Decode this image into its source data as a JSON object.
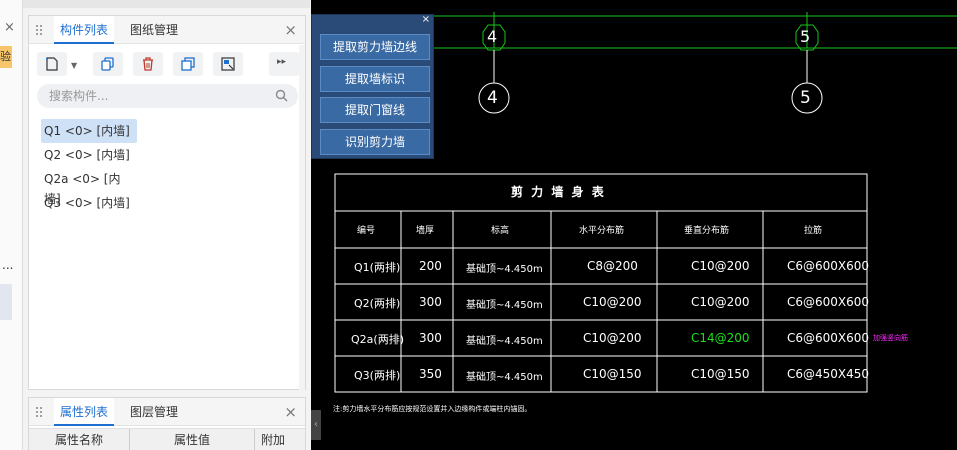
{
  "left_strip": {
    "close_glyph": "×",
    "badge": "验",
    "ellipsis": "..."
  },
  "component_panel": {
    "tabs": [
      "构件列表",
      "图纸管理"
    ],
    "close_glyph": "×",
    "search_placeholder": "搜索构件...",
    "items": [
      "Q1 <0> [内墙]",
      "Q2 <0> [内墙]",
      "Q2a <0> [内墙]",
      "Q3 <0> [内墙]"
    ],
    "selected_index": 0,
    "more_glyph": "▸▸"
  },
  "property_panel": {
    "tabs": [
      "属性列表",
      "图层管理"
    ],
    "close_glyph": "×",
    "columns": [
      "属性名称",
      "属性值",
      "附加"
    ]
  },
  "command_panel": {
    "close_glyph": "×",
    "buttons": [
      "提取剪力墙边线",
      "提取墙标识",
      "提取门窗线",
      "识别剪力墙"
    ]
  },
  "cad": {
    "axis_labels": [
      "4",
      "5"
    ],
    "table": {
      "title": "剪 力 墙 身 表",
      "headers": [
        "编号",
        "墙厚",
        "标高",
        "水平分布筋",
        "垂直分布筋",
        "拉筋"
      ],
      "rows": [
        [
          "Q1(两排)",
          "200",
          "基础顶~4.450m",
          "C8@200",
          "C10@200",
          "C6@600X600"
        ],
        [
          "Q2(两排)",
          "300",
          "基础顶~4.450m",
          "C10@200",
          "C10@200",
          "C6@600X600"
        ],
        [
          "Q2a(两排)",
          "300",
          "基础顶~4.450m",
          "C10@200",
          "C14@200",
          "C6@600X600"
        ],
        [
          "Q3(两排)",
          "350",
          "基础顶~4.450m",
          "C10@150",
          "C10@150",
          "C6@450X450"
        ]
      ],
      "side_note": "加强竖向筋",
      "footnote": "注:剪力墙水平分布筋应按规范设置并入边缘构件或端柱内锚固。"
    },
    "colors": {
      "grid_line": "#19c31b",
      "table_line": "#ffffff",
      "highlight": "#19e01b",
      "note": "#ff28ff"
    }
  }
}
